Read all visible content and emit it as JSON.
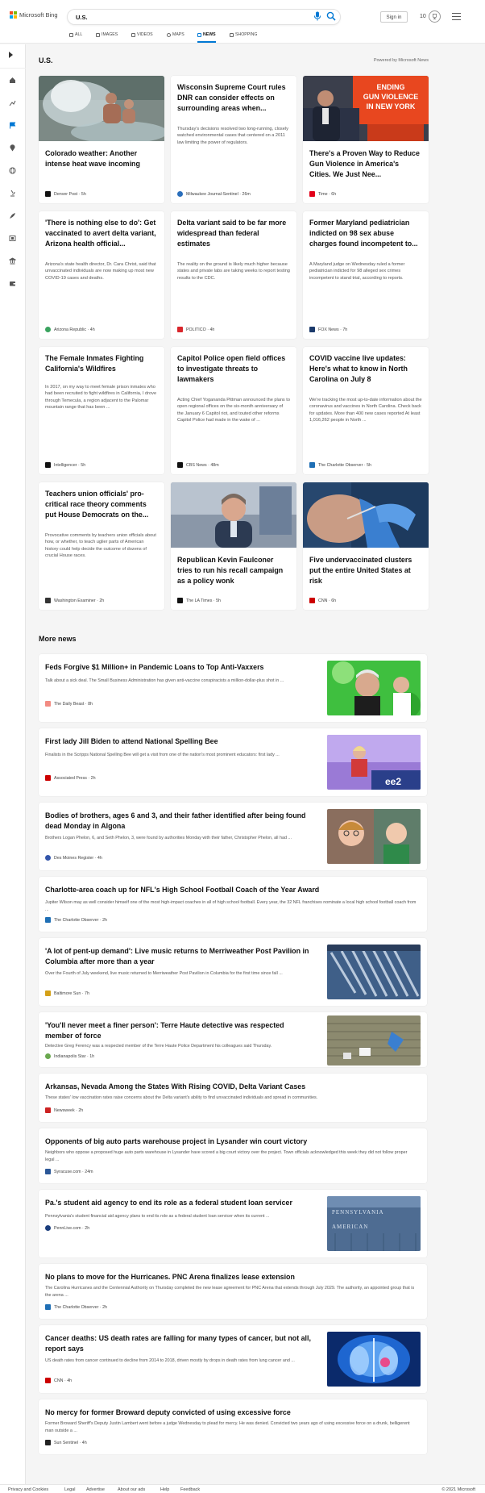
{
  "header": {
    "logo_text": "Microsoft Bing",
    "search_query": "U.S.",
    "signin_label": "Sign in",
    "rewards_count": "10"
  },
  "tabs": [
    {
      "label": "ALL",
      "icon": "search-icon"
    },
    {
      "label": "IMAGES",
      "icon": "image-icon"
    },
    {
      "label": "VIDEOS",
      "icon": "video-icon"
    },
    {
      "label": "MAPS",
      "icon": "map-pin-icon"
    },
    {
      "label": "NEWS",
      "icon": "news-icon",
      "active": true
    },
    {
      "label": "SHOPPING",
      "icon": "shopping-bag-icon"
    }
  ],
  "sidebar": {
    "items": [
      "chevron-right-icon",
      "home-icon",
      "trend-icon",
      "flag-icon",
      "location-icon",
      "globe-icon",
      "microscope-icon",
      "rocket-icon",
      "film-icon",
      "bank-icon",
      "wallet-icon"
    ]
  },
  "section": {
    "title": "U.S.",
    "powered_by": "Powered by Microsoft News"
  },
  "cards": [
    {
      "title": "Colorado weather: Another intense heat wave incoming",
      "snippet": "",
      "source": "Denver Post",
      "age": "5h",
      "logo_color": "#111111"
    },
    {
      "title": "Wisconsin Supreme Court rules DNR can consider effects on surrounding areas when...",
      "snippet": "Thursday's decisions resolved two long-running, closely watched environmental cases that centered on a 2011 law limiting the power of regulators.",
      "source": "Milwaukee Journal-Sentinel",
      "age": "26m",
      "logo_color": "#2a6ebb"
    },
    {
      "title": "There's a Proven Way to Reduce Gun Violence in America's Cities. We Just Nee...",
      "snippet": "",
      "source": "Time",
      "age": "6h",
      "logo_color": "#e2001a"
    },
    {
      "title": "'There is nothing else to do': Get vaccinated to avert delta variant, Arizona health official...",
      "snippet": "Arizona's state health director, Dr. Cara Christ, said that unvaccinated individuals are now making up most new COVID-19 cases and deaths.",
      "source": "Arizona Republic",
      "age": "4h",
      "logo_color": "#3aa35f"
    },
    {
      "title": "Delta variant said to be far more widespread than federal estimates",
      "snippet": "The reality on the ground is likely much higher because states and private labs are taking weeks to report testing results to the CDC.",
      "source": "POLITICO",
      "age": "4h",
      "logo_color": "#d9262c"
    },
    {
      "title": "Former Maryland pediatrician indicted on 98 sex abuse charges found incompetent to...",
      "snippet": "A Maryland judge on Wednesday ruled a former pediatrician indicted for 98 alleged sex crimes incompetent to stand trial, according to reports.",
      "source": "FOX News",
      "age": "7h",
      "logo_color": "#1b3a6b"
    },
    {
      "title": "The Female Inmates Fighting California's Wildfires",
      "snippet": "In 2017, on my way to meet female prison inmates who had been recruited to fight wildfires in California, I drove through Temecula, a region adjacent to the Palomar mountain range that has been ...",
      "source": "Intelligencer",
      "age": "5h",
      "logo_color": "#111111"
    },
    {
      "title": "Capitol Police open field offices to investigate threats to lawmakers",
      "snippet": "Acting Chief Yogananda Pittman announced the plans to open regional offices on the six-month anniversary of the January 6 Capitol riot, and touted other reforms Capitol Police had made in the wake of ...",
      "source": "CBS News",
      "age": "48m",
      "logo_color": "#111111"
    },
    {
      "title": "COVID vaccine live updates: Here's what to know in North Carolina on July 8",
      "snippet": "We're tracking the most up-to-date information about the coronavirus and vaccines in North Carolina. Check back for updates. More than 400 new cases reported At least 1,016,262 people in North ...",
      "source": "The Charlotte Observer",
      "age": "5h",
      "logo_color": "#1f6fb5"
    },
    {
      "title": "Teachers union officials' pro-critical race theory comments put House Democrats on the...",
      "snippet": "Provocative comments by teachers union officials about how, or whether, to teach uglier parts of American history could help decide the outcome of dozens of crucial House races.",
      "source": "Washington Examiner",
      "age": "2h",
      "logo_color": "#333333"
    },
    {
      "title": "Republican Kevin Faulconer tries to run his recall campaign as a policy wonk",
      "snippet": "",
      "source": "The LA Times",
      "age": "5h",
      "logo_color": "#111111"
    },
    {
      "title": "Five undervaccinated clusters put the entire United States at risk",
      "snippet": "",
      "source": "CNN",
      "age": "6h",
      "logo_color": "#cc0000"
    }
  ],
  "more_news": {
    "title": "More news",
    "items": [
      {
        "title": "Feds Forgive $1 Million+ in Pandemic Loans to Top Anti-Vaxxers",
        "snippet": "Talk about a sick deal. The Small Business Administration has given anti-vaccine conspiracists a million-dollar-plus shot in ...",
        "source": "The Daily Beast",
        "age": "8h",
        "logo_color": "#f28b82"
      },
      {
        "title": "First lady Jill Biden to attend National Spelling Bee",
        "snippet": "Finalists in the Scripps National Spelling Bee will get a visit from one of the nation's most prominent educators: first lady ...",
        "source": "Associated Press",
        "age": "2h",
        "logo_color": "#cc0000"
      },
      {
        "title": "Bodies of brothers, ages 6 and 3, and their father identified after being found dead Monday in Algona",
        "snippet": "Brothers Logan Phelon, 6, and Seth Phelon, 3, were found by authorities Monday with their father, Christopher Phelon, all had ...",
        "source": "Des Moines Register",
        "age": "4h",
        "logo_color": "#3355aa"
      },
      {
        "title": "Charlotte-area coach up for NFL's High School Football Coach of the Year Award",
        "snippet": "Jupiter Wilson may as well consider himself one of the most high-impact coaches in all of high school football. Every year, the 32 NFL franchises nominate a local high school football coach from ...",
        "source": "The Charlotte Observer",
        "age": "2h",
        "logo_color": "#1f6fb5"
      },
      {
        "title": "'A lot of pent-up demand': Live music returns to Merriweather Post Pavilion in Columbia after more than a year",
        "snippet": "Over the Fourth of July weekend, live music returned to Merriweather Post Pavilion in Columbia for the first time since fall ...",
        "source": "Baltimore Sun",
        "age": "7h",
        "logo_color": "#d4a017"
      },
      {
        "title": "'You'll never meet a finer person': Terre Haute detective was respected member of force",
        "snippet": "Detective Greg Ferency was a respected member of the Terre Haute Police Department his colleagues said Thursday.",
        "source": "Indianapolis Star",
        "age": "1h",
        "logo_color": "#6aa84f"
      },
      {
        "title": "Arkansas, Nevada Among the States With Rising COVID, Delta Variant Cases",
        "snippet": "These states' low vaccination rates raise concerns about the Delta variant's ability to find unvaccinated individuals and spread in communities.",
        "source": "Newsweek",
        "age": "2h",
        "logo_color": "#cc2222"
      },
      {
        "title": "Opponents of big auto parts warehouse project in Lysander win court victory",
        "snippet": "Neighbors who oppose a proposed huge auto parts warehouse in Lysander have scored a big court victory over the project. Town officials acknowledged this week they did not follow proper legal ...",
        "source": "Syracuse.com",
        "age": "24m",
        "logo_color": "#2b5797"
      },
      {
        "title": "Pa.'s student aid agency to end its role as a federal student loan servicer",
        "snippet": "Pennsylvania's student financial aid agency plans to end its role as a federal student loan servicer when its current ...",
        "source": "PennLive.com",
        "age": "2h",
        "logo_color": "#1a3d7c"
      },
      {
        "title": "No plans to move for the Hurricanes. PNC Arena finalizes lease extension",
        "snippet": "The Carolina Hurricanes and the Centennial Authority on Thursday completed the new lease agreement for PNC Arena that extends through July 2029. The authority, an appointed group that is the arena ...",
        "source": "The Charlotte Observer",
        "age": "2h",
        "logo_color": "#1f6fb5"
      },
      {
        "title": "Cancer deaths: US death rates are falling for many types of cancer, but not all, report says",
        "snippet": "US death rates from cancer continued to decline from 2014 to 2018, driven mostly by drops in death rates from lung cancer and ...",
        "source": "CNN",
        "age": "4h",
        "logo_color": "#cc0000"
      },
      {
        "title": "No mercy for former Broward deputy convicted of using excessive force",
        "snippet": "Former Broward Sheriff's Deputy Justin Lambert went before a judge Wednesday to plead for mercy. He was denied. Convicted two years ago of using excessive force on a drunk, belligerent man outside a ...",
        "source": "Sun Sentinel",
        "age": "4h",
        "logo_color": "#222222"
      }
    ]
  },
  "footer": {
    "links": [
      "Privacy and Cookies",
      "Legal",
      "Advertise",
      "About our ads",
      "Help",
      "Feedback"
    ],
    "copyright": "© 2021 Microsoft"
  }
}
